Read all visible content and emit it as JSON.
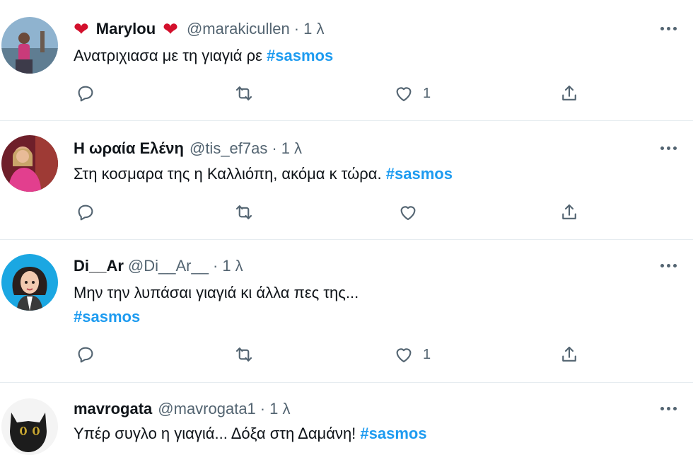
{
  "tweets": [
    {
      "name": "Marylou",
      "name_emoji": "❤",
      "handle": "@marakicullen",
      "separator": "·",
      "time": "1 λ",
      "text_plain": "Ανατριχιασα με τη γιαγιά ρε ",
      "hashtag": "#sasmos",
      "like_count": "1"
    },
    {
      "name": "Η ωραία Ελένη",
      "handle": "@tis_ef7as",
      "separator": "·",
      "time": "1 λ",
      "text_plain": "Στη κοσμαρα της η Καλλιόπη, ακόμα κ τώρα. ",
      "hashtag": "#sasmos",
      "like_count": ""
    },
    {
      "name": "Di__Ar",
      "handle": "@Di__Ar__",
      "separator": "·",
      "time": "1 λ",
      "text_plain": "Μην την λυπάσαι γιαγιά κι άλλα πες της...",
      "hashtag": "#sasmos",
      "like_count": "1"
    },
    {
      "name": "mavrogata",
      "handle": "@mavrogata1",
      "separator": "·",
      "time": "1 λ",
      "text_plain": "Υπέρ συγλο η γιαγιά... Δόξα στη Δαμάνη! ",
      "hashtag": "#sasmos",
      "like_count": ""
    }
  ],
  "colors": {
    "link": "#1d9bf0",
    "secondary_text": "#536471",
    "primary_text": "#0f1419",
    "divider": "#e6ecf0",
    "emoji_heart": "#d3102c"
  },
  "icons": {
    "reply": "reply-icon",
    "retweet": "retweet-icon",
    "like": "like-icon",
    "share": "share-icon",
    "more": "more-icon"
  }
}
